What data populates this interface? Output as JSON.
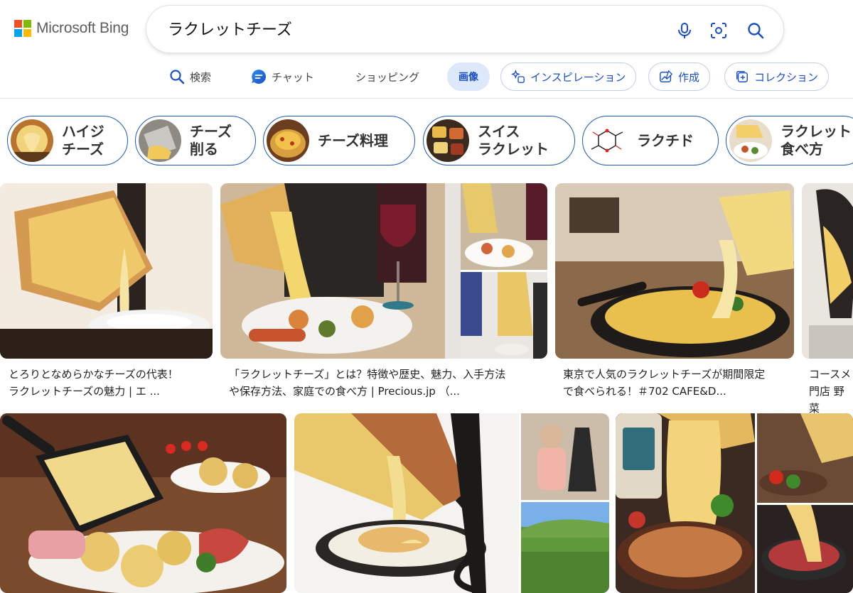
{
  "brand": {
    "name": "Microsoft Bing",
    "logo_colors": [
      "#f25022",
      "#7fba00",
      "#00a4ef",
      "#ffb900"
    ]
  },
  "search": {
    "query": "ラクレットチーズ",
    "icons": [
      "microphone-icon",
      "visual-search-icon",
      "search-icon"
    ]
  },
  "nav": {
    "tabs": [
      {
        "label": "検索",
        "icon": "search-icon"
      },
      {
        "label": "チャット",
        "icon": "copilot-chat-icon"
      },
      {
        "label": "ショッピング",
        "icon": ""
      },
      {
        "label": "画像",
        "icon": "",
        "active": true
      },
      {
        "label": "インスピレーション",
        "icon": "sparkle-icon"
      },
      {
        "label": "作成",
        "icon": "image-create-icon"
      },
      {
        "label": "コレクション",
        "icon": "collection-icon"
      }
    ]
  },
  "suggestions": [
    {
      "label": "ハイジ\nチーズ"
    },
    {
      "label": "チーズ\n削る"
    },
    {
      "label": "チーズ料理"
    },
    {
      "label": "スイス\nラクレット"
    },
    {
      "label": "ラクチド"
    },
    {
      "label": "ラクレット\n食べ方"
    }
  ],
  "results_row1": [
    {
      "caption": "とろりとなめらかなチーズの代表！\nラクレットチーズの魅力 | エ ..."
    },
    {
      "caption": "「ラクレットチーズ」とは？特徴や歴史、魅力、入手方法\nや保存方法、家庭での食べ方 | Precious.jp （..."
    },
    {
      "caption": "東京で人気のラクレットチーズが期間限定\nで食べられる！＃702 CAFE&D..."
    },
    {
      "caption": "コースメ\n門店 野菜"
    }
  ],
  "colors": {
    "accent": "#1a4fc3",
    "chip_border": "#1c59b5",
    "active_tab_bg": "#dde8fb"
  }
}
